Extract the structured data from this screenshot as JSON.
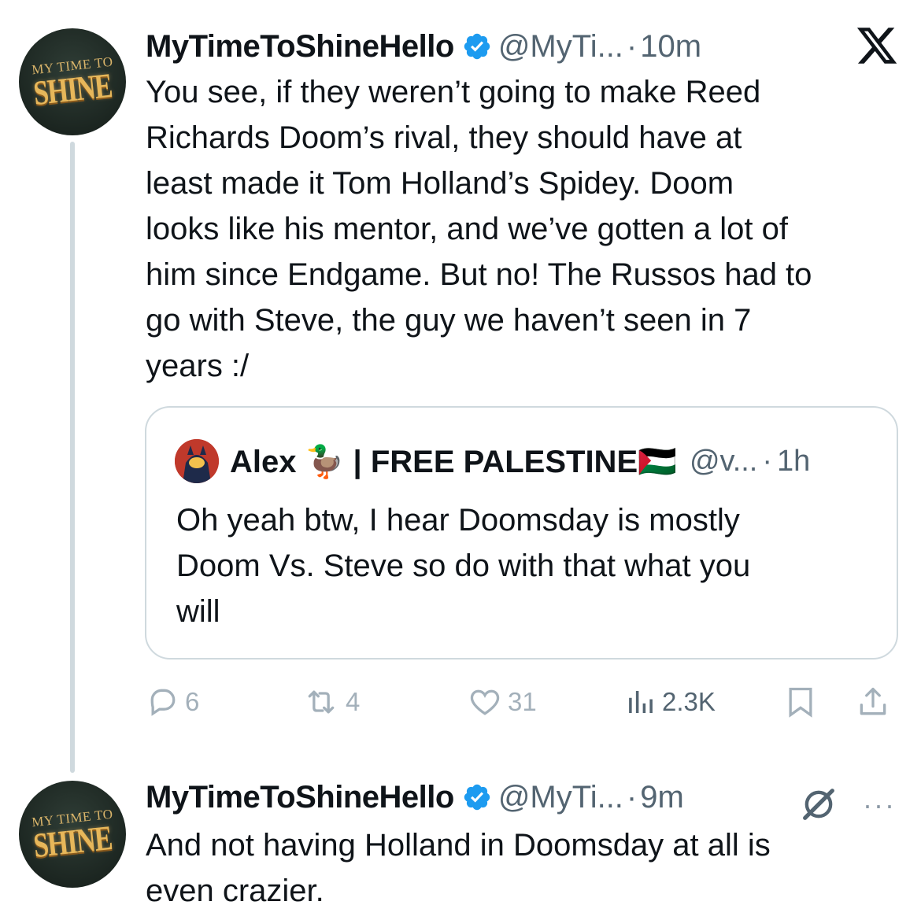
{
  "tweet1": {
    "avatar_line1": "MY TIME TO",
    "avatar_line2": "SHINE",
    "name": "MyTimeToShineHello",
    "handle": "@MyTi...",
    "separator": "·",
    "time": "10m",
    "body_lines": [
      "You see, if they weren’t going to make Reed",
      "Richards Doom’s rival, they should have at",
      "least made it Tom Holland’s Spidey. Doom",
      "looks like his mentor, and we’ve gotten a lot of",
      "him since Endgame. But no! The Russos had to",
      "go with Steve, the guy we haven’t seen in 7",
      "years :/"
    ],
    "quote": {
      "name": "Alex 🦆 | FREE PALESTINE🇵🇸",
      "handle": "@v...",
      "separator": "·",
      "time": "1h",
      "body_lines": [
        "Oh yeah btw, I hear Doomsday is mostly",
        "Doom Vs. Steve so do with that what you",
        "will"
      ]
    },
    "actions": {
      "replies": "6",
      "reposts": "4",
      "likes": "31",
      "views": "2.3K"
    },
    "icons": [
      "x-logo-icon",
      "verified-badge-icon",
      "reply-icon",
      "repost-icon",
      "like-icon",
      "views-icon",
      "bookmark-icon",
      "share-icon"
    ],
    "colors": {
      "verified": "#1d9bf0",
      "action_grey": "#a3b0ba",
      "thread_line": "#cfd9de"
    }
  },
  "tweet2": {
    "avatar_line1": "MY TIME TO",
    "avatar_line2": "SHINE",
    "name": "MyTimeToShineHello",
    "handle": "@MyTi...",
    "separator": "·",
    "time": "9m",
    "more": "···",
    "body_lines": [
      "And not having Holland in Doomsday at all is",
      "even crazier."
    ]
  }
}
